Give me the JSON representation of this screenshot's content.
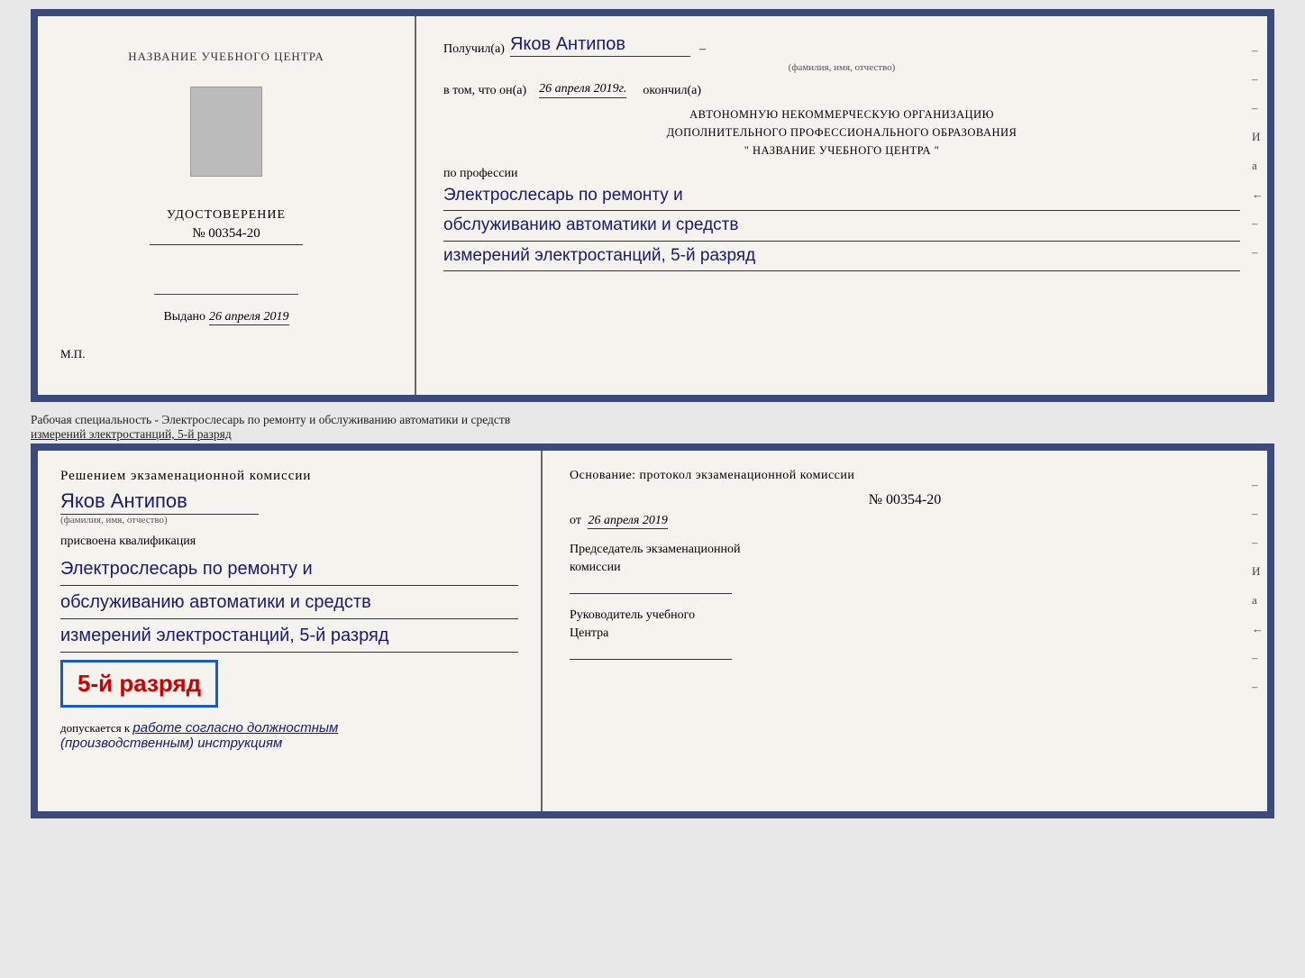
{
  "topLeft": {
    "centerTitle": "НАЗВАНИЕ УЧЕБНОГО ЦЕНТРА",
    "udostoverenie": "УДОСТОВЕРЕНИЕ",
    "number": "№ 00354-20",
    "vydano": "Выдано",
    "vydanoDate": "26 апреля 2019",
    "mp": "М.П."
  },
  "topRight": {
    "poluchilLabel": "Получил(а)",
    "poluchilName": "Яков Антипов",
    "famLabel": "(фамилия, имя, отчество)",
    "vtomLabel": "в том, что он(а)",
    "vtomDate": "26 апреля 2019г.",
    "okonchilLabel": "окончил(а)",
    "institutionLine1": "АВТОНОМНУЮ НЕКОММЕРЧЕСКУЮ ОРГАНИЗАЦИЮ",
    "institutionLine2": "ДОПОЛНИТЕЛЬНОГО ПРОФЕССИОНАЛЬНОГО ОБРАЗОВАНИЯ",
    "institutionLine3": "\"  НАЗВАНИЕ УЧЕБНОГО ЦЕНТРА  \"",
    "poProfessii": "по профессии",
    "profession1": "Электрослесарь по ремонту и",
    "profession2": "обслуживанию автоматики и средств",
    "profession3": "измерений электростанций, 5-й разряд",
    "sideDashes": [
      "-",
      "-",
      "-",
      "И",
      "а",
      "←",
      "-",
      "-"
    ]
  },
  "betweenText": {
    "line1": "Рабочая специальность - Электрослесарь по ремонту и обслуживанию автоматики и средств",
    "line2": "измерений электростанций, 5-й разряд"
  },
  "bottomLeft": {
    "resheniemTitle": "Решением экзаменационной комиссии",
    "name": "Яков Антипов",
    "famLabel": "(фамилия, имя, отчество)",
    "prisvoena": "присвоена квалификация",
    "qual1": "Электрослесарь по ремонту и",
    "qual2": "обслуживанию автоматики и средств",
    "qual3": "измерений электростанций, 5-й разряд",
    "razryadBadge": "5-й разряд",
    "dopuskaetsya": "допускается к",
    "dopuskText": "работе согласно должностным",
    "dopuskText2": "(производственным) инструкциям"
  },
  "bottomRight": {
    "osnovaniyeLabel": "Основание: протокол экзаменационной комиссии",
    "protocolNumber": "№ 00354-20",
    "otLabel": "от",
    "protocolDate": "26 апреля 2019",
    "predsedatelLabel": "Председатель экзаменационной",
    "komissiiLabel": "комиссии",
    "rukovoditelLabel": "Руководитель учебного",
    "centreLabel": "Центра",
    "sideDashes": [
      "-",
      "-",
      "-",
      "И",
      "а",
      "←",
      "-",
      "-"
    ]
  }
}
